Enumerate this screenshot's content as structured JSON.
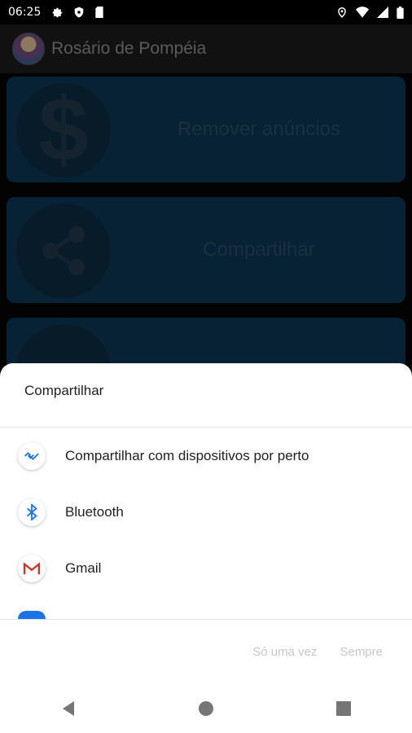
{
  "status_bar": {
    "time": "06:25",
    "left_icons": [
      "gear-icon",
      "shield-icon",
      "sim-card-icon"
    ],
    "right_icons": [
      "location-icon",
      "wifi-icon",
      "signal-icon",
      "battery-icon"
    ]
  },
  "app_bar": {
    "title": "Rosário de Pompéia"
  },
  "cards": [
    {
      "label": "Remover anúncios",
      "icon": "dollar-icon"
    },
    {
      "label": "Compartilhar",
      "icon": "share-icon"
    }
  ],
  "share_sheet": {
    "title": "Compartilhar",
    "items": [
      {
        "label": "Compartilhar com dispositivos por perto",
        "icon": "nearby-share-icon",
        "color": "#1a73e8"
      },
      {
        "label": "Bluetooth",
        "icon": "bluetooth-icon",
        "color": "#1a73e8"
      },
      {
        "label": "Gmail",
        "icon": "gmail-icon",
        "color": "#d93025"
      }
    ],
    "just_once_label": "Só uma vez",
    "always_label": "Sempre"
  },
  "nav_bar": {
    "buttons": [
      "back-icon",
      "home-icon",
      "recents-icon"
    ]
  }
}
